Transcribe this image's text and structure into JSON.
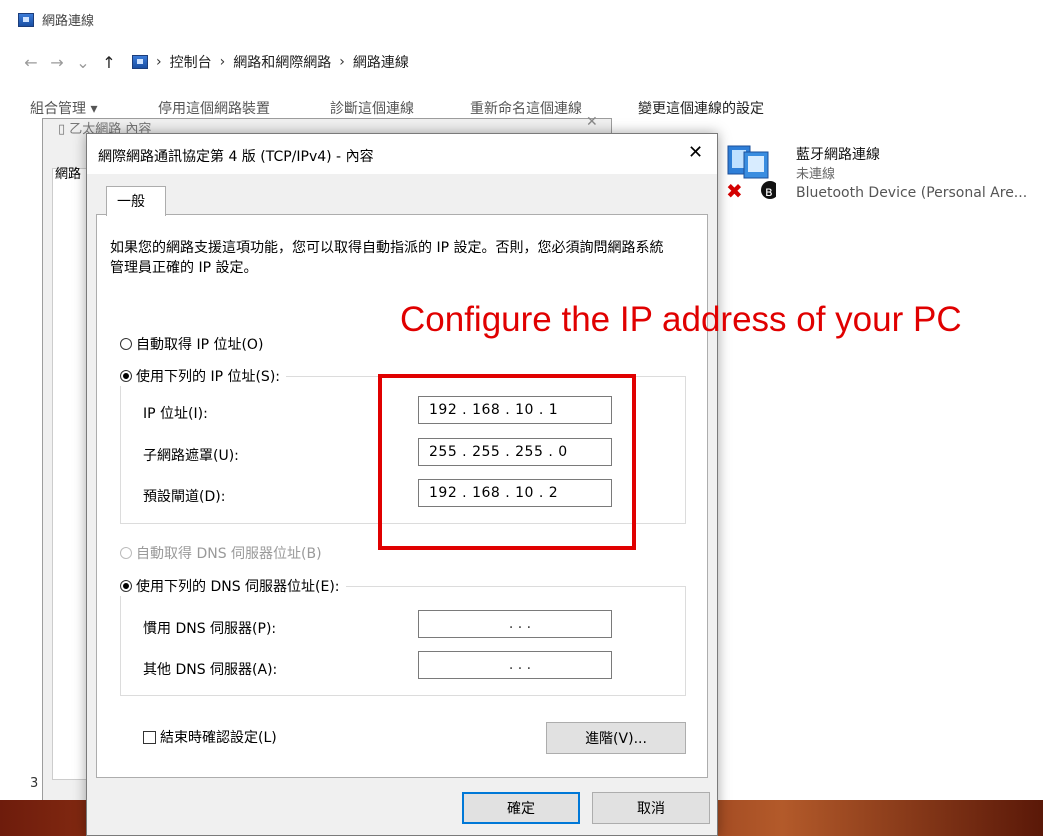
{
  "explorer": {
    "title": "網路連線",
    "nav": {
      "back": "←",
      "forward": "→",
      "recent": "⌄",
      "up": "↑"
    },
    "breadcrumb": [
      "控制台",
      "網路和網際網路",
      "網路連線"
    ],
    "breadcrumb_sep": "›",
    "toolbar": {
      "organize": "組合管理 ▾",
      "disable": "停用這個網路裝置",
      "diagnose": "診斷這個連線",
      "rename": "重新命名這個連線",
      "change": "變更這個連線的設定"
    },
    "connection": {
      "name": "藍牙網路連線",
      "status": "未連線",
      "device": "Bluetooth Device (Personal Are..."
    },
    "status_count": "3"
  },
  "bg_dialog": {
    "title": "乙太網路 內容",
    "tab": "網路"
  },
  "dialog": {
    "title": "網際網路通訊協定第 4 版 (TCP/IPv4) - 內容",
    "close": "✕",
    "tab_general": "一般",
    "description": "如果您的網路支援這項功能，您可以取得自動指派的 IP 設定。否則，您必須詢問網路系統管理員正確的 IP 設定。",
    "ip_auto": "自動取得 IP 位址(O)",
    "ip_manual": "使用下列的 IP 位址(S):",
    "ip_address_label": "IP 位址(I):",
    "ip_address": "192 . 168 . 10 . 1",
    "subnet_label": "子網路遮罩(U):",
    "subnet": "255 . 255 . 255 . 0",
    "gateway_label": "預設閘道(D):",
    "gateway": "192 . 168 . 10 . 2",
    "dns_auto": "自動取得 DNS 伺服器位址(B)",
    "dns_manual": "使用下列的 DNS 伺服器位址(E):",
    "preferred_dns_label": "慣用 DNS 伺服器(P):",
    "preferred_dns": ".         .         .",
    "alternate_dns_label": "其他 DNS 伺服器(A):",
    "alternate_dns": ".         .         .",
    "validate_label": "結束時確認設定(L)",
    "advanced": "進階(V)...",
    "ok": "確定",
    "cancel": "取消"
  },
  "annotation": "Configure the IP address of your PC",
  "colors": {
    "annotation": "#e00000",
    "focus_border": "#0078d7"
  }
}
